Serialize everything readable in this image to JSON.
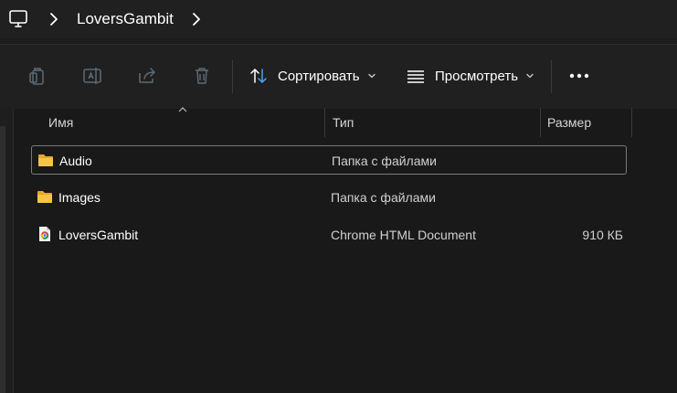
{
  "addressbar": {
    "pc_icon": "monitor-icon",
    "breadcrumb": "LoversGambit"
  },
  "commandbar": {
    "copy_icon": "copy-icon",
    "rename_icon": "rename-icon",
    "share_icon": "share-icon",
    "delete_icon": "delete-icon",
    "sort_label": "Сортировать",
    "view_label": "Просмотреть",
    "more_icon": "more-icon"
  },
  "columns": {
    "name": "Имя",
    "type": "Тип",
    "size": "Размер"
  },
  "files": [
    {
      "name": "Audio",
      "type": "Папка с файлами",
      "size": "",
      "icon": "folder-icon",
      "selected": true
    },
    {
      "name": "Images",
      "type": "Папка с файлами",
      "size": "",
      "icon": "folder-icon",
      "selected": false
    },
    {
      "name": "LoversGambit",
      "type": "Chrome HTML Document",
      "size": "910 КБ",
      "icon": "chrome-html-file-icon",
      "selected": false
    }
  ],
  "colors": {
    "background": "#191919",
    "toolbar": "#202020",
    "folder": "#f6c544",
    "accent": "#4ea1f5"
  }
}
